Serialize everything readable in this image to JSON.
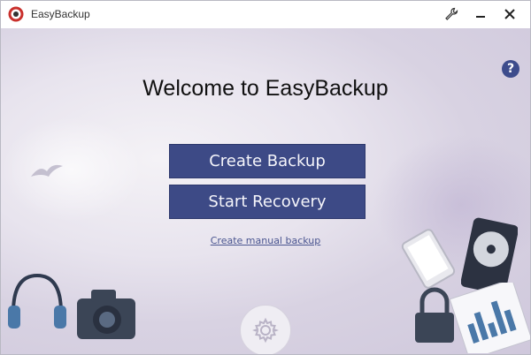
{
  "window": {
    "title": "EasyBackup",
    "controls": {
      "settings_icon": "wrench-icon",
      "minimize_icon": "minimize-icon",
      "close_icon": "close-icon"
    }
  },
  "main": {
    "heading": "Welcome to EasyBackup",
    "buttons": {
      "create_backup": "Create Backup",
      "start_recovery": "Start Recovery"
    },
    "manual_backup_link": "Create manual backup",
    "help_label": "?",
    "settings_icon": "gear-icon"
  },
  "colors": {
    "button_bg": "#3d4a86",
    "help_bg": "#3d4c8c",
    "link": "#4a5590"
  }
}
